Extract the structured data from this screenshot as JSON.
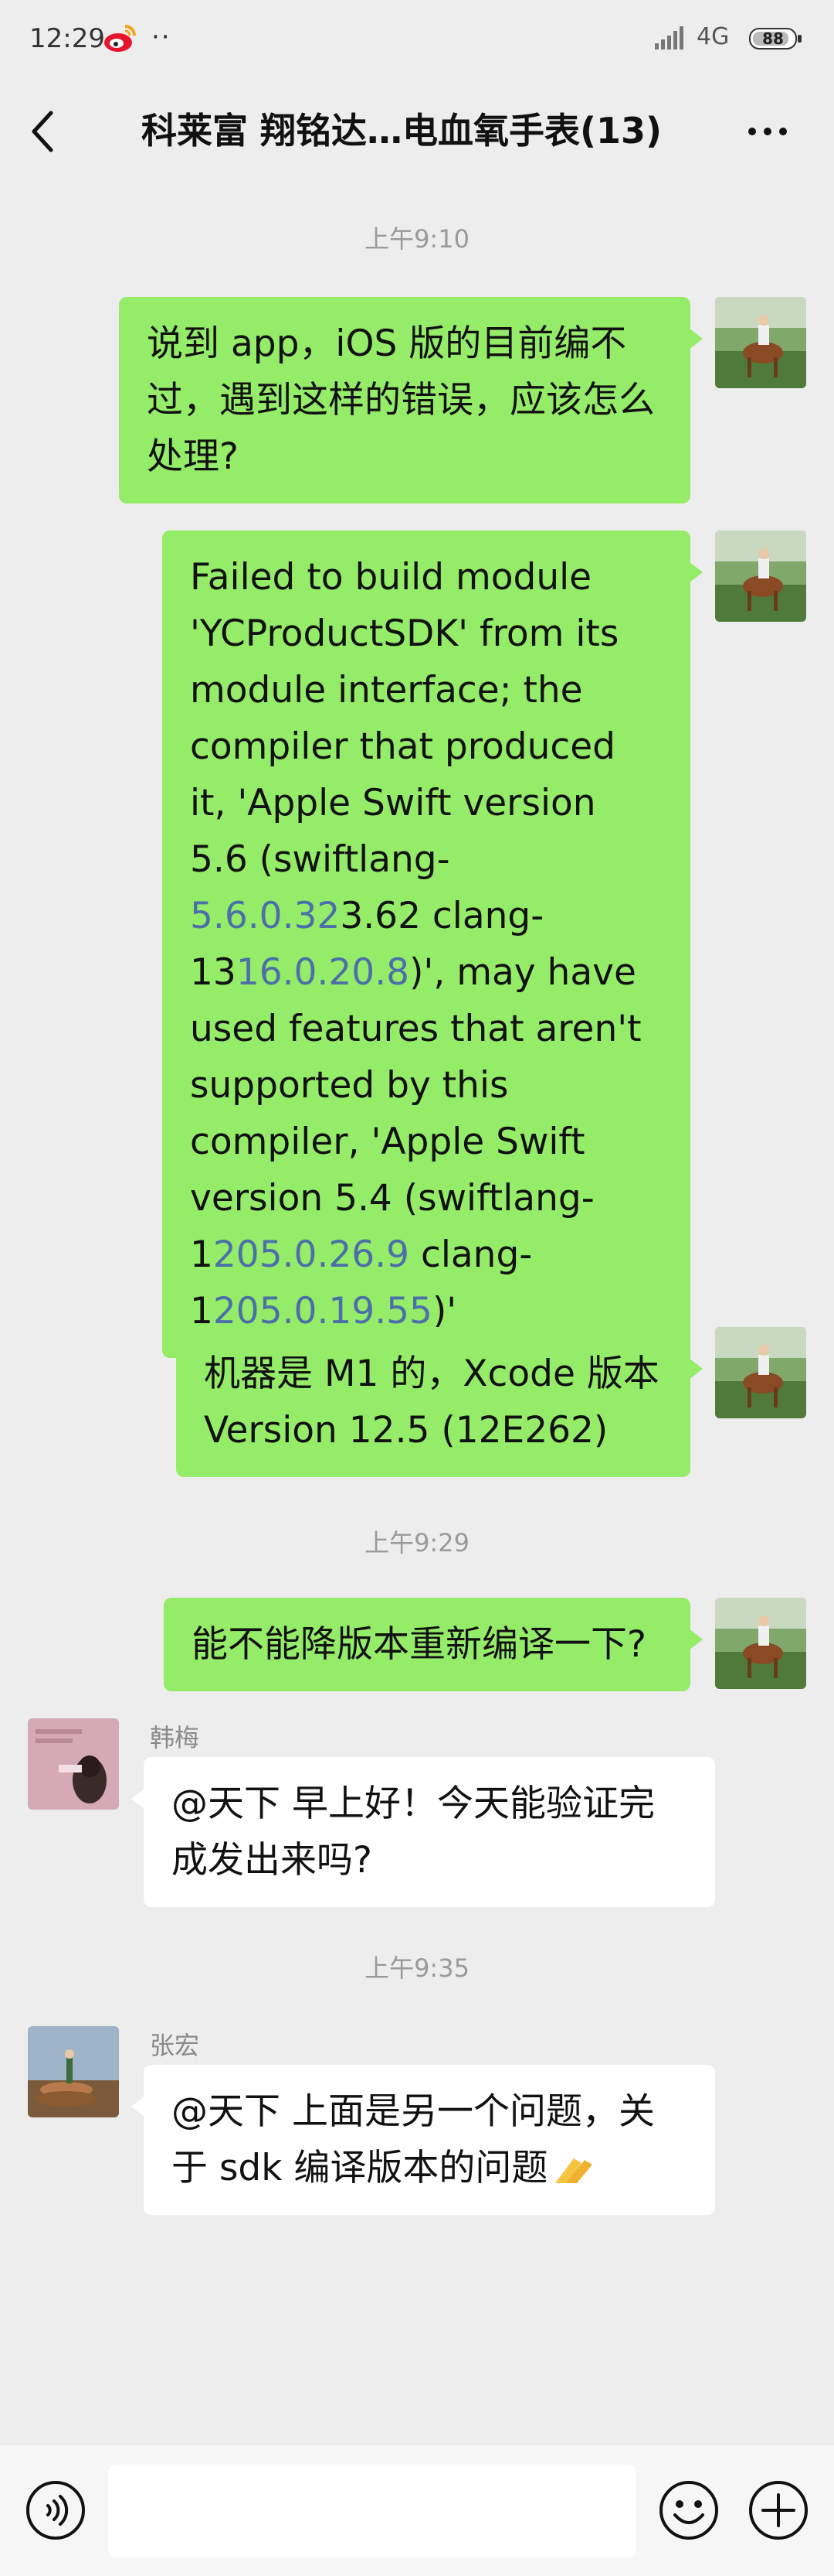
{
  "status_bar": {
    "time": "12:29",
    "extra": "··",
    "network": "4G",
    "battery": "88"
  },
  "nav": {
    "title": "科莱富 翔铭达…电血氧手表(13)"
  },
  "timestamps": [
    "上午9:10",
    "上午9:29",
    "上午9:35"
  ],
  "messages": [
    {
      "text": "说到 app，iOS 版的目前编不过，遇到这样的错误，应该怎么处理?"
    },
    {
      "segments": [
        {
          "t": "Failed to build module 'YCProductSDK' from its module interface; the compiler that produced it, 'Apple Swift version 5.6 (swiftlang-"
        },
        {
          "t": "5.6.0.32",
          "link": true
        },
        {
          "t": "3.62 clang-13"
        },
        {
          "t": "16.0.20.8",
          "link": true
        },
        {
          "t": ")', may have used features that aren't supported by this compiler, 'Apple Swift version 5.4 (swiftlang-1"
        },
        {
          "t": "205.0.26.9",
          "link": true
        },
        {
          "t": " clang-1"
        },
        {
          "t": "205.0.19.55",
          "link": true
        },
        {
          "t": ")'"
        }
      ]
    },
    {
      "text": "机器是 M1 的，Xcode 版本 Version 12.5 (12E262)"
    },
    {
      "text": "能不能降版本重新编译一下?"
    },
    {
      "sender": "韩梅",
      "text": "@天下  早上好！今天能验证完成发出来吗?"
    },
    {
      "sender": "张宏",
      "text": "@天下  上面是另一个问题，关于 sdk 编译版本的问题"
    }
  ],
  "input": {
    "placeholder": ""
  },
  "colors": {
    "my_bubble": "#95ec69",
    "other_bubble": "#ffffff",
    "background": "#ededed",
    "link": "#4c6fa8"
  }
}
